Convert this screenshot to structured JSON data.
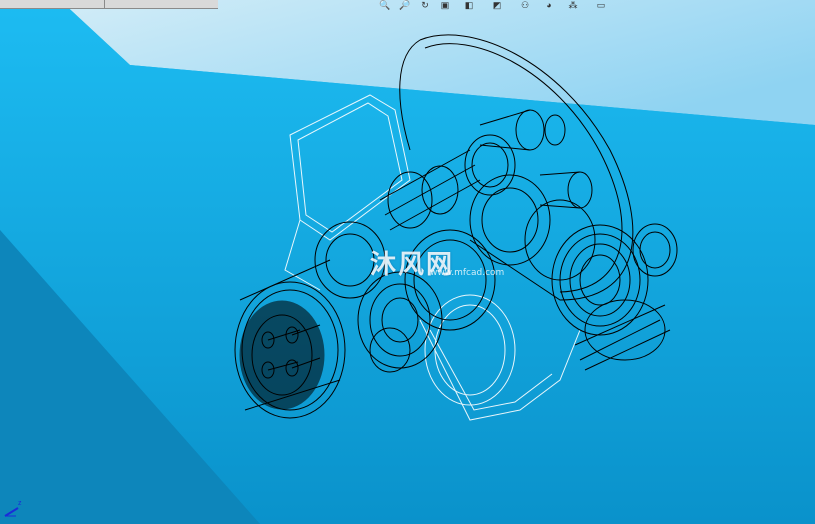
{
  "toolbar": {
    "icons": [
      {
        "name": "zoom-to-fit-icon",
        "glyph": "🔍"
      },
      {
        "name": "zoom-in-icon",
        "glyph": "🔎"
      },
      {
        "name": "rotate-view-icon",
        "glyph": "↻"
      },
      {
        "name": "section-view-icon",
        "glyph": "▣"
      },
      {
        "name": "view-orientation-icon",
        "glyph": "◧"
      },
      {
        "name": "display-style-icon",
        "glyph": "◩"
      },
      {
        "name": "hide-show-icon",
        "glyph": "⚇"
      },
      {
        "name": "appearance-icon",
        "glyph": "◕"
      },
      {
        "name": "scene-icon",
        "glyph": "⁂"
      },
      {
        "name": "monitor-icon",
        "glyph": "▭"
      }
    ]
  },
  "watermark": {
    "text": "沐风网",
    "url": "www.mfcad.com"
  },
  "triad": {
    "axis_label": "z"
  },
  "colors": {
    "background_top": "#18b7ee",
    "background_bottom": "#0a8fc6",
    "wireframe": "#000000",
    "edge_highlight": "#ffffff"
  }
}
